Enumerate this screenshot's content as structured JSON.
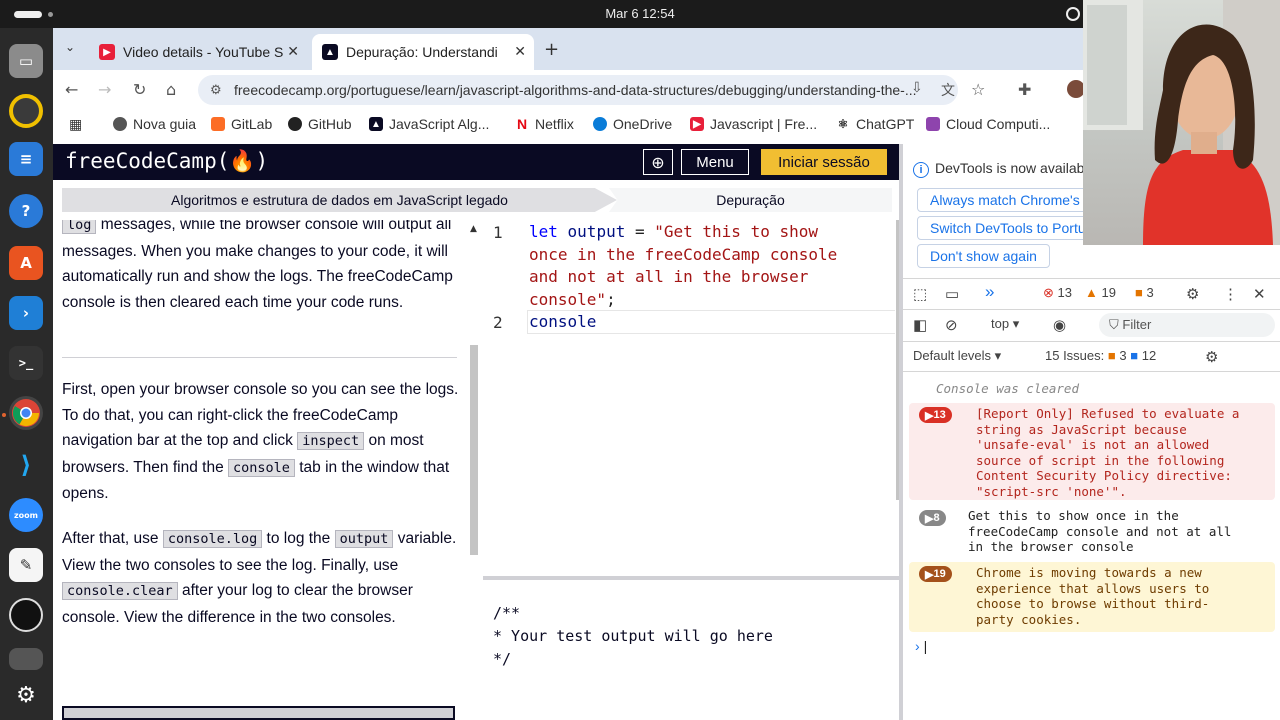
{
  "system": {
    "clock": "Mar 6  12:54"
  },
  "browser": {
    "tabs": [
      {
        "title": "Video details - YouTube S",
        "active": false,
        "fav_color": "#e8203a"
      },
      {
        "title": "Depuração: Understandi",
        "active": true,
        "fav_color": "#0a0a23"
      }
    ],
    "url": "freecodecamp.org/portuguese/learn/javascript-algorithms-and-data-structures/debugging/understanding-the-...",
    "bookmarks": [
      "Nova guia",
      "GitLab",
      "GitHub",
      "JavaScript Alg...",
      "Netflix",
      "OneDrive",
      "Javascript | Fre...",
      "ChatGPT",
      "Cloud Computi..."
    ]
  },
  "fcc": {
    "logo": "freeCodeCamp(🔥)",
    "menu_label": "Menu",
    "signin_label": "Iniciar sessão",
    "breadcrumb": [
      "Algoritmos e estrutura de dados em JavaScript legado",
      "Depuração"
    ]
  },
  "instructions": {
    "p0": {
      "code": "log",
      "rest": " messages, while the browser console will output all messages. When you make changes to your code, it will automatically run and show the logs. The freeCodeCamp console is then cleared each time your code runs."
    },
    "p1": {
      "t1": "First, open your browser console so you can see the logs. To do that, you can right-click the freeCodeCamp navigation bar at the top and click ",
      "c1": "inspect",
      "t2": " on most browsers. Then find the ",
      "c2": "console",
      "t3": " tab in the window that opens."
    },
    "p2": {
      "t1": "After that, use ",
      "c1": "console.log",
      "t2": " to log the ",
      "c2": "output",
      "t3": " variable. View the two consoles to see the log. Finally, use ",
      "c3": "console.clear",
      "t4": " after your log to clear the browser console. View the difference in the two consoles."
    }
  },
  "editor": {
    "line_numbers": [
      "1",
      "2"
    ],
    "line1": {
      "kw": "let",
      "var": " output ",
      "op": "= ",
      "str_a": "\"Get this to show",
      "str_b": "once in the freeCodeCamp console",
      "str_c": "and not at all in the browser",
      "str_d": "console\"",
      "end": ";"
    },
    "line2": "console"
  },
  "output": {
    "lines": [
      "/**",
      "* Your test output will go here",
      "*/"
    ]
  },
  "devtools": {
    "info": "DevTools is now availab",
    "buttons": [
      "Always match Chrome's",
      "Switch DevTools to Portu",
      "Don't show again"
    ],
    "counts": {
      "errors": "13",
      "warnings": "19",
      "issues": "3"
    },
    "context": "top",
    "filter_placeholder": "Filter",
    "levels": "Default levels",
    "issues_label": "15 Issues:",
    "issues_warn": "3",
    "issues_info": "12",
    "cleared": "Console was cleared",
    "messages": [
      {
        "count": "13",
        "kind": "error",
        "text": "[Report Only] Refused to evaluate a\nstring as JavaScript because\n'unsafe-eval' is not an allowed\nsource of script in the following\nContent Security Policy directive:\n\"script-src 'none'\"."
      },
      {
        "count": "8",
        "kind": "log",
        "text": "Get this to show once in the\nfreeCodeCamp console and not at all\nin the browser console"
      },
      {
        "count": "19",
        "kind": "warning",
        "text": "Chrome is moving towards a new\nexperience that allows users to\nchoose to browse without third-\nparty cookies."
      }
    ]
  },
  "colors": {
    "fcc_dark": "#0a0a23",
    "fcc_yellow": "#f1be32",
    "error_bg": "#fcebeb",
    "warning_bg": "#fef6d5",
    "link_blue": "#1a73e8"
  }
}
